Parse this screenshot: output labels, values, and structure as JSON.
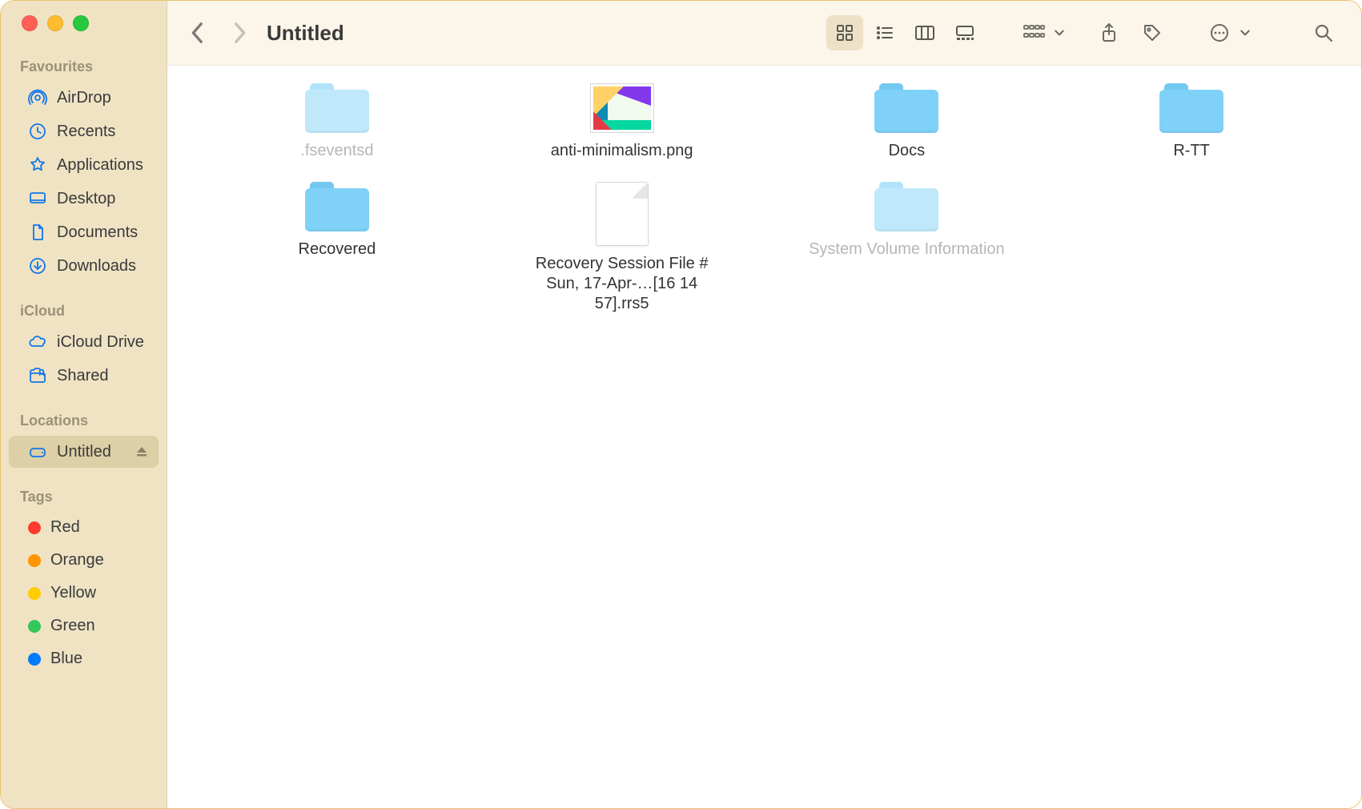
{
  "window_title": "Untitled",
  "sidebar": {
    "sections": [
      {
        "head": "Favourites",
        "items": [
          {
            "icon": "airdrop",
            "label": "AirDrop"
          },
          {
            "icon": "recents",
            "label": "Recents"
          },
          {
            "icon": "applications",
            "label": "Applications"
          },
          {
            "icon": "desktop",
            "label": "Desktop"
          },
          {
            "icon": "documents",
            "label": "Documents"
          },
          {
            "icon": "downloads",
            "label": "Downloads"
          }
        ]
      },
      {
        "head": "iCloud",
        "items": [
          {
            "icon": "icloud",
            "label": "iCloud Drive"
          },
          {
            "icon": "shared",
            "label": "Shared"
          }
        ]
      },
      {
        "head": "Locations",
        "items": [
          {
            "icon": "disk",
            "label": "Untitled",
            "selected": true,
            "eject": true
          }
        ]
      },
      {
        "head": "Tags",
        "items": [
          {
            "icon": "tag",
            "color": "#ff3b30",
            "label": "Red"
          },
          {
            "icon": "tag",
            "color": "#ff9500",
            "label": "Orange"
          },
          {
            "icon": "tag",
            "color": "#ffcc00",
            "label": "Yellow"
          },
          {
            "icon": "tag",
            "color": "#34c759",
            "label": "Green"
          },
          {
            "icon": "tag",
            "color": "#007aff",
            "label": "Blue"
          }
        ]
      }
    ]
  },
  "files": [
    {
      "type": "folder",
      "dim": true,
      "name": ".fseventsd"
    },
    {
      "type": "image",
      "name": "anti-minimalism.png"
    },
    {
      "type": "folder",
      "name": "Docs"
    },
    {
      "type": "folder",
      "name": "R-TT"
    },
    {
      "type": "folder",
      "name": "Recovered"
    },
    {
      "type": "document",
      "name": "Recovery Session File # Sun, 17-Apr-…[16 14 57].rrs5"
    },
    {
      "type": "folder",
      "dim": true,
      "name": "System Volume Information"
    }
  ]
}
